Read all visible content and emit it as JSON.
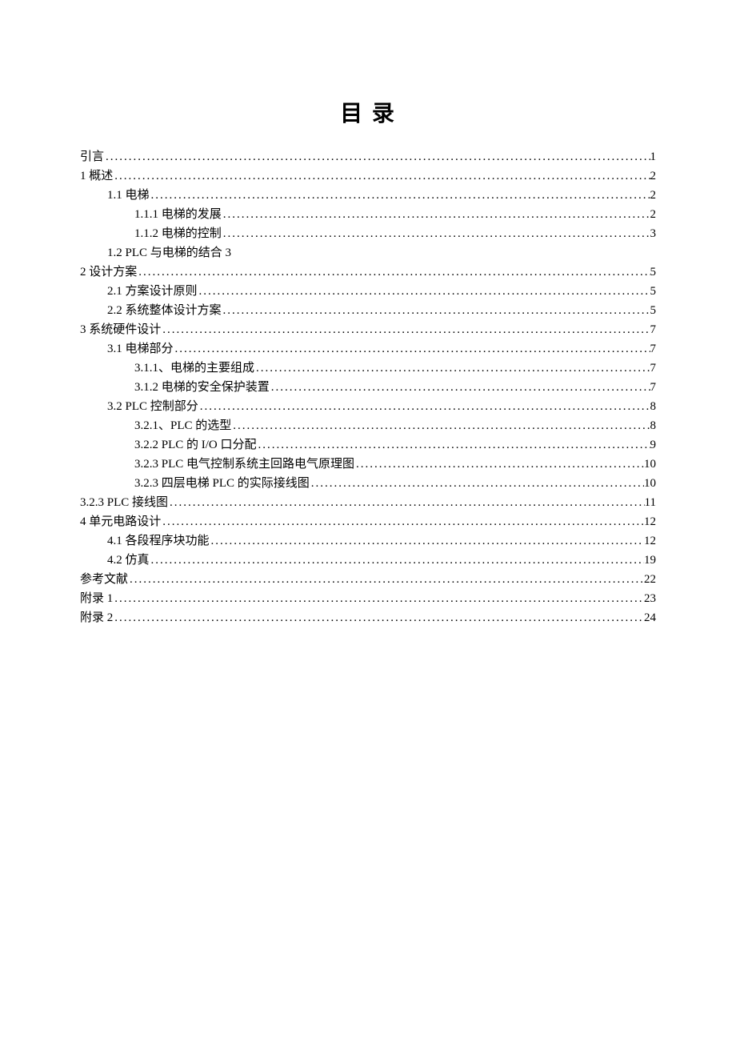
{
  "title": "目    录",
  "entries": [
    {
      "level": 0,
      "label": "引言",
      "page": "1"
    },
    {
      "level": 0,
      "label": "1 概述",
      "page": "2"
    },
    {
      "level": 1,
      "label": "1.1 电梯",
      "page": "2"
    },
    {
      "level": 2,
      "label": "1.1.1 电梯的发展",
      "page": "2"
    },
    {
      "level": 2,
      "label": "1.1.2 电梯的控制",
      "page": "3"
    },
    {
      "level": 1,
      "label": "1.2 PLC 与电梯的结合 3",
      "page": "",
      "noDots": true
    },
    {
      "level": 0,
      "label": "2 设计方案",
      "page": "5"
    },
    {
      "level": 1,
      "label": "2.1 方案设计原则",
      "page": "5"
    },
    {
      "level": 1,
      "label": "2.2 系统整体设计方案",
      "page": "5"
    },
    {
      "level": 0,
      "label": "3 系统硬件设计",
      "page": "7"
    },
    {
      "level": 1,
      "label": "3.1 电梯部分",
      "page": "7"
    },
    {
      "level": 2,
      "label": "3.1.1、电梯的主要组成",
      "page": "7"
    },
    {
      "level": 2,
      "label": "3.1.2 电梯的安全保护装置",
      "page": "7"
    },
    {
      "level": 1,
      "label": "3.2 PLC 控制部分",
      "page": "8"
    },
    {
      "level": 2,
      "label": "3.2.1、PLC 的选型",
      "page": "8"
    },
    {
      "level": 2,
      "label": "3.2.2 PLC 的 I/O 口分配",
      "page": "9"
    },
    {
      "level": 2,
      "label": "3.2.3 PLC 电气控制系统主回路电气原理图",
      "page": "10"
    },
    {
      "level": 2,
      "label": "3.2.3 四层电梯 PLC 的实际接线图",
      "page": "10"
    },
    {
      "level": 0,
      "label": "3.2.3 PLC 接线图",
      "page": "11"
    },
    {
      "level": 0,
      "label": "4 单元电路设计",
      "page": "12"
    },
    {
      "level": 1,
      "label": "4.1 各段程序块功能",
      "page": "12"
    },
    {
      "level": 1,
      "label": "4.2 仿真",
      "page": "19"
    },
    {
      "level": 0,
      "label": "参考文献",
      "page": "22"
    },
    {
      "level": 0,
      "label": "附录 1",
      "page": "23"
    },
    {
      "level": 0,
      "label": "附录 2",
      "page": "24"
    }
  ]
}
